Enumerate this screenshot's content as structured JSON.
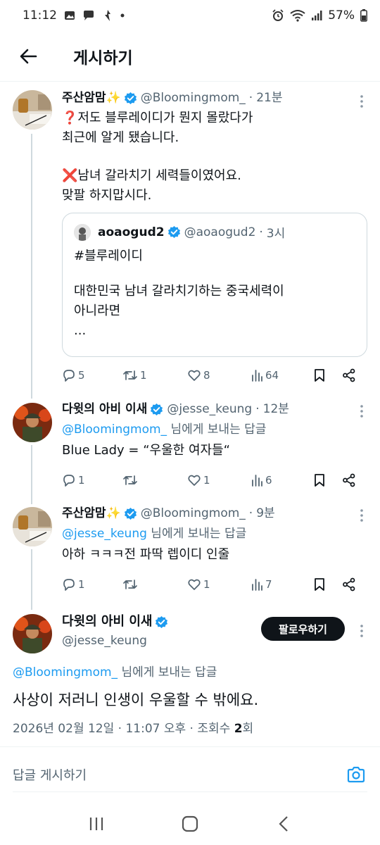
{
  "status_bar": {
    "time": "11:12",
    "battery": "57%"
  },
  "header": {
    "title": "게시하기"
  },
  "tweets": [
    {
      "name": "주산암맘",
      "sparkle": "✨",
      "handle": "@Bloomingmom_",
      "dot": "·",
      "time": "21분",
      "text1": "❓저도 블루레이디가 뭔지 몰랐다가\n최근에 알게 됐습니다.",
      "text2": "❌남녀 갈라치기 세력들이였어요.\n맞팔 하지맙시다.",
      "quote": {
        "name": "aoaogud2",
        "handle": "@aoaogud2",
        "dot": "·",
        "time": "3시",
        "text1": "#블루레이디",
        "text2": "대한민국 남녀 갈라치기하는 중국세력이\n아니라면\n..."
      },
      "replies": "5",
      "retweets": "1",
      "likes": "8",
      "views": "64"
    },
    {
      "name": "다윗의 아비 이새",
      "handle": "@jesse_keung",
      "dot": "·",
      "time": "12분",
      "reply_mention": "@Bloomingmom_",
      "reply_suffix": " 님에게 보내는 답글",
      "text": "Blue Lady = “우울한 여자들“",
      "replies": "1",
      "retweets": "",
      "likes": "1",
      "views": "6"
    },
    {
      "name": "주산암맘",
      "sparkle": "✨",
      "handle": "@Bloomingmom_",
      "dot": "·",
      "time": "9분",
      "reply_mention": "@jesse_keung",
      "reply_suffix": " 님에게 보내는 답글",
      "text": "아하 ㅋㅋㅋ전 파딱 렙이디 인줄",
      "replies": "1",
      "retweets": "",
      "likes": "1",
      "views": "7"
    }
  ],
  "focus": {
    "name": "다윗의 아비 이새",
    "handle": "@jesse_keung",
    "follow_label": "팔로우하기",
    "reply_mention": "@Bloomingmom_",
    "reply_suffix": " 님에게 보내는 답글",
    "text": "사상이 저러니 인생이 우울할 수 밖에요.",
    "meta_prefix": "2026년 02월 12일 · 11:07 오후 · 조회수 ",
    "views": "2",
    "meta_suffix": "회"
  },
  "compose": {
    "placeholder": "답글 게시하기"
  },
  "colors": {
    "accent": "#1d9bf0",
    "text": "#0f1419",
    "muted": "#536471",
    "border": "#cfd9de"
  },
  "icons": [
    "back-arrow-icon",
    "verified-badge-icon",
    "more-icon",
    "reply-icon",
    "retweet-icon",
    "like-icon",
    "views-icon",
    "bookmark-icon",
    "share-icon",
    "camera-icon"
  ]
}
